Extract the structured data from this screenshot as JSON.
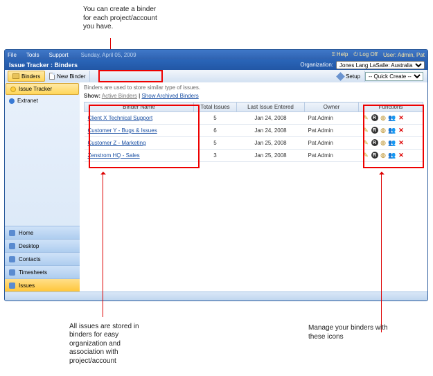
{
  "annotations": {
    "top": "You can create a binder for each project/account you have.",
    "bottom_left": "All issues are stored in binders for easy organization and association with project/account",
    "bottom_right": "Manage your binders with these icons"
  },
  "menubar": {
    "file": "File",
    "tools": "Tools",
    "support": "Support",
    "date": "Sunday, April 05, 2009",
    "help": "Help",
    "logoff": "Log Off",
    "userinfo": "User: Admin, Pat"
  },
  "titlebar": {
    "title": "Issue Tracker : Binders",
    "org_label": "Organization:",
    "org_value": "Jones Lang LaSalle: Australia"
  },
  "toolbar": {
    "binders": "Binders",
    "new_binder": "New Binder",
    "setup": "Setup",
    "quick_create": "-- Quick Create --"
  },
  "sidebar": {
    "top": [
      {
        "label": "Issue Tracker"
      },
      {
        "label": "Extranet"
      }
    ],
    "bottom": [
      {
        "label": "Home"
      },
      {
        "label": "Desktop"
      },
      {
        "label": "Contacts"
      },
      {
        "label": "Timesheets"
      },
      {
        "label": "Issues"
      }
    ]
  },
  "main": {
    "hint": "Binders are used to store similar type of issues.",
    "show_label": "Show:",
    "show_active": "Active Binders",
    "show_sep": " | ",
    "show_archived": "Show Archived Binders",
    "columns": {
      "name": "Binder Name",
      "total": "Total Issues",
      "last": "Last Issue Entered",
      "owner": "Owner",
      "functions": "Functions"
    },
    "rows": [
      {
        "name": "Client X Technical Support",
        "total": "5",
        "last": "Jan 24, 2008",
        "owner": "Pat Admin"
      },
      {
        "name": "Customer Y - Bugs & Issues",
        "total": "6",
        "last": "Jan 24, 2008",
        "owner": "Pat Admin"
      },
      {
        "name": "Customer Z - Marketing",
        "total": "5",
        "last": "Jan 25, 2008",
        "owner": "Pat Admin"
      },
      {
        "name": "Zenstrom HQ - Sales",
        "total": "3",
        "last": "Jan 25, 2008",
        "owner": "Pat Admin"
      }
    ]
  }
}
